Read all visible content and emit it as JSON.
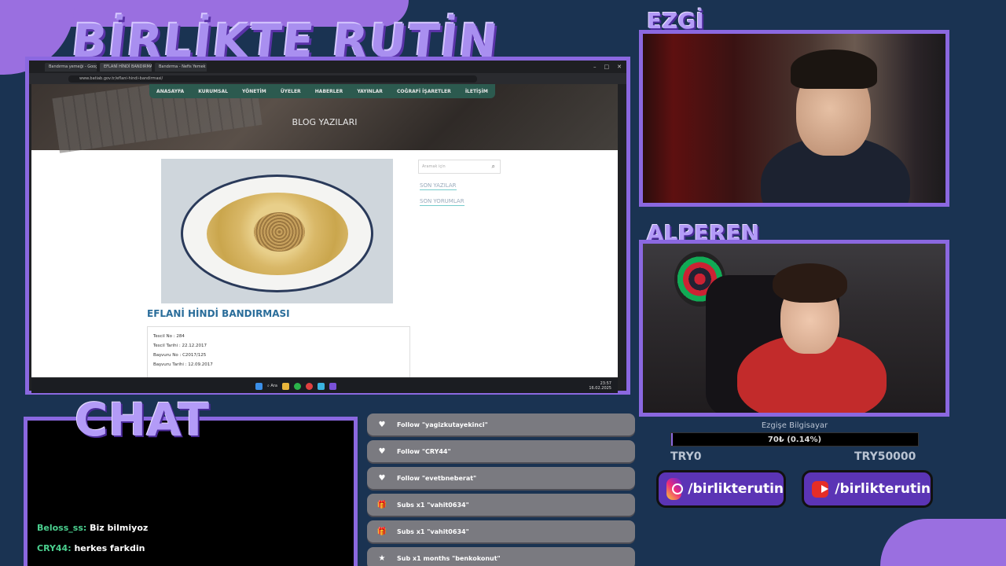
{
  "overlay": {
    "title": "BİRLİKTE RUTİN",
    "cam1_label": "EZGİ",
    "cam2_label": "ALPEREN",
    "chat_label": "CHAT"
  },
  "browser": {
    "tabs": [
      "Bandırma yemeği - Goog",
      "EFLANİ HİNDİ BANDIRMAS",
      "Bandırma - Nefis Yemek T"
    ],
    "url": "www.batiab.gov.tr/eflani-hindi-bandirmasi/",
    "nav": [
      "ANASAYFA",
      "KURUMSAL",
      "YÖNETİM",
      "ÜYELER",
      "HABERLER",
      "YAYINLAR",
      "COĞRAFİ İŞARETLER",
      "İLETİŞİM"
    ],
    "hero_title": "BLOG YAZILARI",
    "post_title": "EFLANİ HİNDİ BANDIRMASI",
    "info": [
      "Tescil No : 284",
      "Tescil Tarihi : 22.12.2017",
      "Başvuru No : C2017/125",
      "Başvuru Tarihi : 12.09.2017"
    ],
    "search_placeholder": "Aramak için",
    "side_links": [
      "SON YAZILAR",
      "SON YORUMLAR"
    ],
    "taskbar_search": "Ara",
    "clock_time": "23:57",
    "clock_date": "16.02.2025"
  },
  "chat": {
    "messages": [
      {
        "user": "Beloss_ss:",
        "text": "Biz bilmiyoz"
      },
      {
        "user": "CRY44:",
        "text": "herkes farkdin"
      }
    ]
  },
  "alerts": [
    {
      "icon": "heart-icon",
      "glyph": "♥",
      "prefix": "Follow",
      "name": "\"yagizkutayekinci\""
    },
    {
      "icon": "heart-icon",
      "glyph": "♥",
      "prefix": "Follow",
      "name": "\"CRY44\""
    },
    {
      "icon": "heart-icon",
      "glyph": "♥",
      "prefix": "Follow",
      "name": "\"evetbneberat\""
    },
    {
      "icon": "gift-icon",
      "glyph": "🎁",
      "prefix": "Subs x1",
      "name": "\"vahit0634\""
    },
    {
      "icon": "gift-icon",
      "glyph": "🎁",
      "prefix": "Subs x1",
      "name": "\"vahit0634\""
    },
    {
      "icon": "star-icon",
      "glyph": "★",
      "prefix": "Sub x1 months",
      "name": "\"benkokonut\""
    }
  ],
  "donation": {
    "title": "Ezgişe Bilgisayar",
    "progress_text": "70₺ (0.14%)",
    "progress_fraction": 0.0014,
    "min_label": "TRY0",
    "max_label": "TRY50000"
  },
  "socials": {
    "instagram": "/birlikterutin",
    "youtube": "/birlikterutin"
  },
  "colors": {
    "background": "#1a3352",
    "frame": "#8b68e0",
    "chat_user": "#4bd08f",
    "social_bg": "#5b34b5"
  }
}
